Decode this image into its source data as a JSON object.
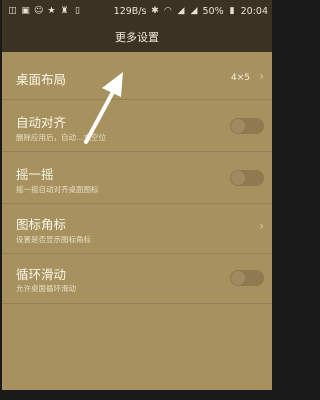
{
  "status_bar": {
    "left_icons": [
      "notification-icon",
      "gallery-icon",
      "cat-icon",
      "star-icon",
      "app-icon",
      "tablet-icon"
    ],
    "speed": "129B/s",
    "right_icons": [
      "bluetooth-icon",
      "wifi-icon",
      "signal-icon",
      "signal-icon"
    ],
    "battery": "50%",
    "time": "20:04"
  },
  "header": {
    "title": "更多设置"
  },
  "settings": {
    "layout": {
      "label": "桌面布局",
      "value": "4×5"
    },
    "auto_align": {
      "label": "自动对齐",
      "sub": "删除应用后，自动…充空位",
      "enabled": false
    },
    "shake": {
      "label": "摇一摇",
      "sub": "摇一摇自动对齐桌面图标",
      "enabled": false
    },
    "badge": {
      "label": "图标角标",
      "sub": "设置是否显示图标角标"
    },
    "loop_scroll": {
      "label": "循环滑动",
      "sub": "允许桌面循环滑动",
      "enabled": false
    }
  },
  "colors": {
    "background": "#a7925f",
    "header": "#3b3224",
    "arrow": "#ffffff"
  }
}
